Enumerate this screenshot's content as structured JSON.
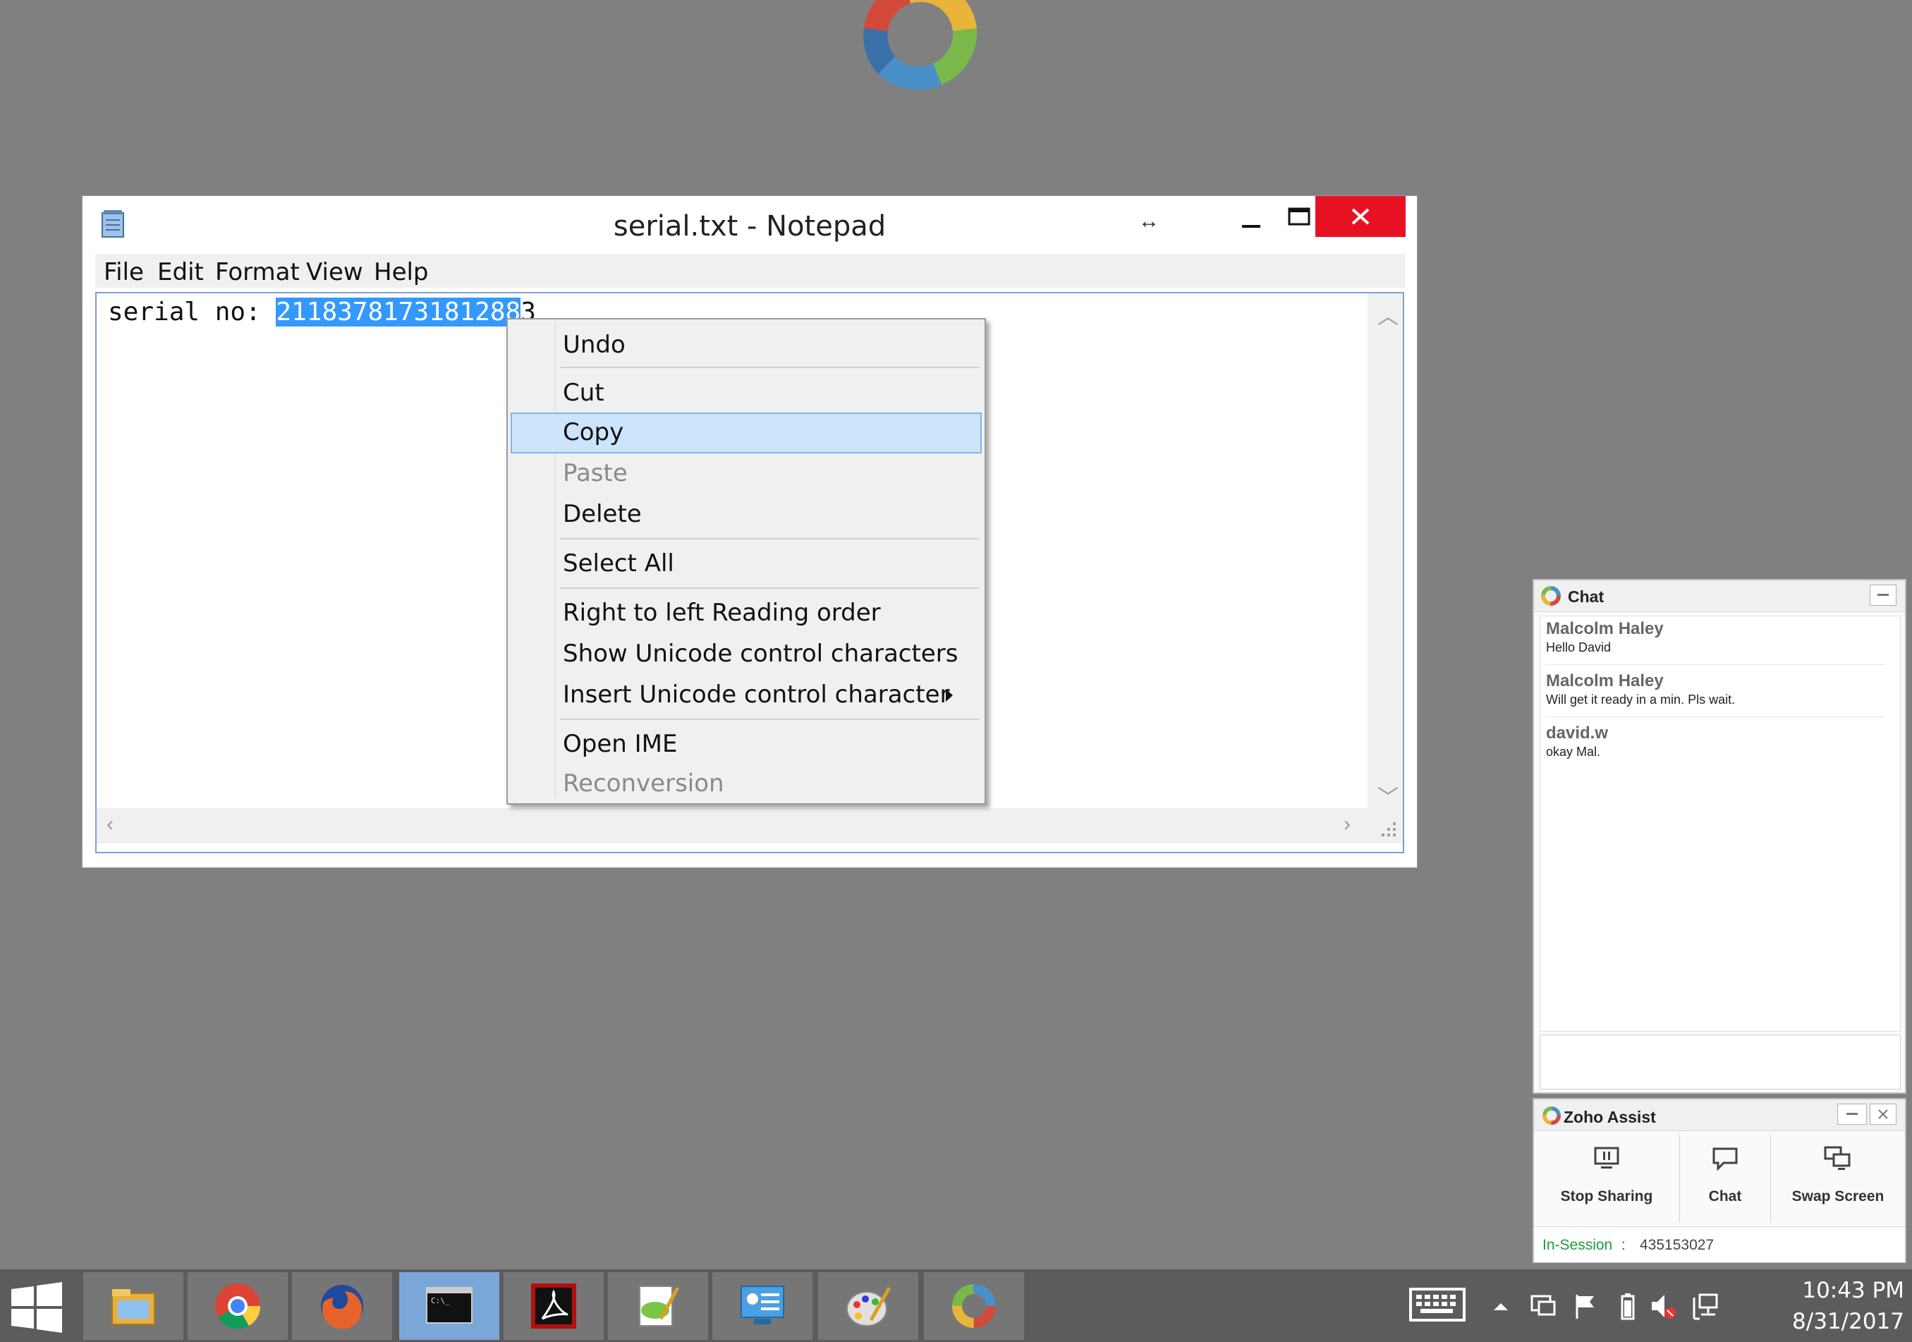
{
  "notepad": {
    "title": "serial.txt - Notepad",
    "menu": [
      "File",
      "Edit",
      "Format",
      "View",
      "Help"
    ],
    "content_prefix": "serial no: ",
    "content_selected": "2118378173181288",
    "content_partial": "3"
  },
  "context_menu": {
    "items": [
      {
        "label": "Undo",
        "enabled": true
      },
      {
        "label": "Cut",
        "enabled": true
      },
      {
        "label": "Copy",
        "enabled": true,
        "highlighted": true
      },
      {
        "label": "Paste",
        "enabled": false
      },
      {
        "label": "Delete",
        "enabled": true
      },
      {
        "label": "Select All",
        "enabled": true
      },
      {
        "label": "Right to left Reading order",
        "enabled": true
      },
      {
        "label": "Show Unicode control characters",
        "enabled": true
      },
      {
        "label": "Insert Unicode control character",
        "enabled": true,
        "submenu": true
      },
      {
        "label": "Open IME",
        "enabled": true
      },
      {
        "label": "Reconversion",
        "enabled": false
      }
    ]
  },
  "chat": {
    "title": "Chat",
    "messages": [
      {
        "sender": "Malcolm Haley",
        "text": "Hello David"
      },
      {
        "sender": "Malcolm Haley",
        "text": "Will get it ready in a min. Pls wait."
      },
      {
        "sender": "david.w",
        "text": "okay Mal."
      }
    ]
  },
  "zoho_assist": {
    "title": "Zoho Assist",
    "buttons": [
      {
        "label": "Stop Sharing",
        "icon": "pause-screen-icon"
      },
      {
        "label": "Chat",
        "icon": "chat-bubble-icon"
      },
      {
        "label": "Swap Screen",
        "icon": "swap-screen-icon"
      }
    ],
    "status_label": "In-Session",
    "status_separator": ":",
    "session_id": "435153027",
    "status_color": "#1a9e3a"
  },
  "taskbar": {
    "apps": [
      "file-explorer-icon",
      "chrome-icon",
      "firefox-icon",
      "command-prompt-icon",
      "acrobat-icon",
      "notepad-plus-icon",
      "control-panel-icon",
      "paint-icon",
      "zoho-assist-icon"
    ],
    "clock_time": "10:43 PM",
    "clock_date": "8/31/2017"
  },
  "colors": {
    "desktop": "#808080",
    "selection": "#3399ff",
    "menu_highlight": "#cce4fc",
    "close_button": "#e81123"
  }
}
